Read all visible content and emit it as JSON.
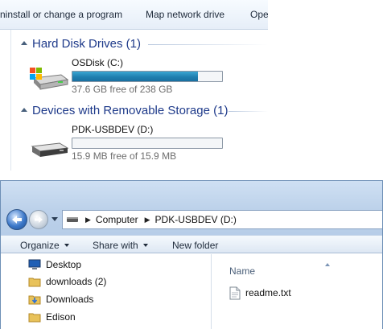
{
  "top_window": {
    "toolbar": {
      "uninstall_label": "ninstall or change a program",
      "map_drive_label": "Map network drive",
      "open_label": "Ope"
    },
    "groups": [
      {
        "title": "Hard Disk Drives (1)",
        "drives": [
          {
            "name": "OSDisk (C:)",
            "free_text": "37.6 GB free of 238 GB",
            "used_fraction": 0.84,
            "icon": "windows-hard-drive-icon"
          }
        ]
      },
      {
        "title": "Devices with Removable Storage (1)",
        "drives": [
          {
            "name": "PDK-USBDEV (D:)",
            "free_text": "15.9 MB free of 15.9 MB",
            "used_fraction": 0.0,
            "icon": "usb-drive-icon"
          }
        ]
      }
    ],
    "colors": {
      "group_title": "#1e3a8a",
      "bar_fill": "#2689bd",
      "free_text": "#6d6d6d"
    }
  },
  "explorer": {
    "address": {
      "crumbs": [
        "Computer",
        "PDK-USBDEV (D:)"
      ],
      "separator": "▶"
    },
    "commands": {
      "organize": "Organize",
      "share_with": "Share with",
      "new_folder": "New folder"
    },
    "nav_items": [
      {
        "label": "Desktop",
        "icon": "desktop-icon"
      },
      {
        "label": "downloads (2)",
        "icon": "folder-icon"
      },
      {
        "label": "Downloads",
        "icon": "downloads-folder-icon"
      },
      {
        "label": "Edison",
        "icon": "folder-icon"
      }
    ],
    "columns": {
      "name": "Name"
    },
    "files": [
      {
        "name": "readme.txt",
        "icon": "text-file-icon"
      }
    ]
  }
}
